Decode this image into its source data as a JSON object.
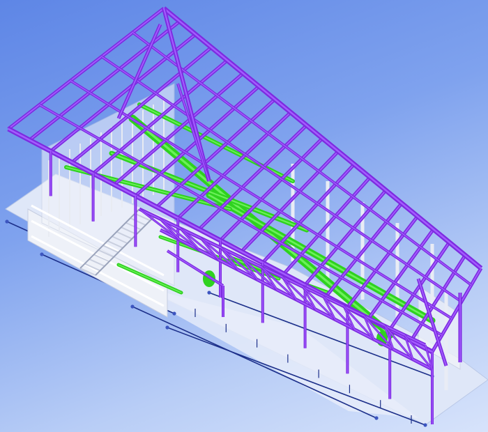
{
  "scene": {
    "kind": "isometric-bim-structural-model",
    "background_top": "#5e86e6",
    "background_bottom": "#d7e3fb",
    "layers": [
      {
        "name": "steel-framing",
        "color": "#7d2be0",
        "highlight": "#a35cff"
      },
      {
        "name": "mechanical-ductwork",
        "color": "#2fd21f",
        "highlight": "#6cf05a"
      },
      {
        "name": "architectural-elements",
        "color": "#e8ebf2",
        "highlight": "#ffffff"
      },
      {
        "name": "gridlines",
        "color": "#1c2f8a",
        "highlight": "#3c55c0"
      }
    ]
  }
}
